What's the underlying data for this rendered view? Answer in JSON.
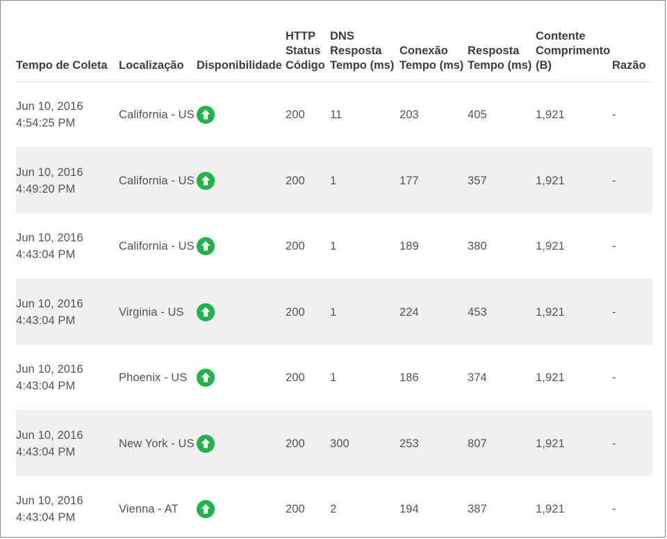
{
  "table": {
    "columns": [
      {
        "key": "collect_time",
        "label": "Tempo de Coleta"
      },
      {
        "key": "location",
        "label": "Localização"
      },
      {
        "key": "availability",
        "label": "Disponibilidade"
      },
      {
        "key": "http_status",
        "label": "HTTP Status Código"
      },
      {
        "key": "dns_time",
        "label": "DNS Resposta Tempo (ms)"
      },
      {
        "key": "connection_time",
        "label": "Conexão Tempo (ms)"
      },
      {
        "key": "response_time",
        "label": "Resposta Tempo (ms)"
      },
      {
        "key": "content_length",
        "label": "Contente Comprimento (B)"
      },
      {
        "key": "ratio",
        "label": "Razão"
      }
    ],
    "availability_icon": {
      "name": "availability-up-arrow-icon",
      "color": "#21b24b",
      "arrow_color": "#ffffff",
      "state": "up"
    },
    "rows": [
      {
        "date": "Jun 10, 2016",
        "time": "4:54:25 PM",
        "location": "California - US",
        "availability": "up",
        "http_status": "200",
        "dns_time": "11",
        "connection_time": "203",
        "response_time": "405",
        "content_length": "1,921",
        "ratio": "-"
      },
      {
        "date": "Jun 10, 2016",
        "time": "4:49:20 PM",
        "location": "California - US",
        "availability": "up",
        "http_status": "200",
        "dns_time": "1",
        "connection_time": "177",
        "response_time": "357",
        "content_length": "1,921",
        "ratio": "-"
      },
      {
        "date": "Jun 10, 2016",
        "time": "4:43:04 PM",
        "location": "California - US",
        "availability": "up",
        "http_status": "200",
        "dns_time": "1",
        "connection_time": "189",
        "response_time": "380",
        "content_length": "1,921",
        "ratio": "-"
      },
      {
        "date": "Jun 10, 2016",
        "time": "4:43:04 PM",
        "location": "Virginia - US",
        "availability": "up",
        "http_status": "200",
        "dns_time": "1",
        "connection_time": "224",
        "response_time": "453",
        "content_length": "1,921",
        "ratio": "-"
      },
      {
        "date": "Jun 10, 2016",
        "time": "4:43:04 PM",
        "location": "Phoenix - US",
        "availability": "up",
        "http_status": "200",
        "dns_time": "1",
        "connection_time": "186",
        "response_time": "374",
        "content_length": "1,921",
        "ratio": "-"
      },
      {
        "date": "Jun 10, 2016",
        "time": "4:43:04 PM",
        "location": "New York - US",
        "availability": "up",
        "http_status": "200",
        "dns_time": "300",
        "connection_time": "253",
        "response_time": "807",
        "content_length": "1,921",
        "ratio": "-"
      },
      {
        "date": "Jun 10, 2016",
        "time": "4:43:04 PM",
        "location": "Vienna - AT",
        "availability": "up",
        "http_status": "200",
        "dns_time": "2",
        "connection_time": "194",
        "response_time": "387",
        "content_length": "1,921",
        "ratio": "-"
      }
    ]
  },
  "colors": {
    "header_text": "#3c3c3c",
    "body_text": "#4c535b",
    "stripe_background": "#f0f0f0",
    "divider": "#e6e6e6",
    "page_border": "#898989",
    "status_green": "#21b24b"
  }
}
